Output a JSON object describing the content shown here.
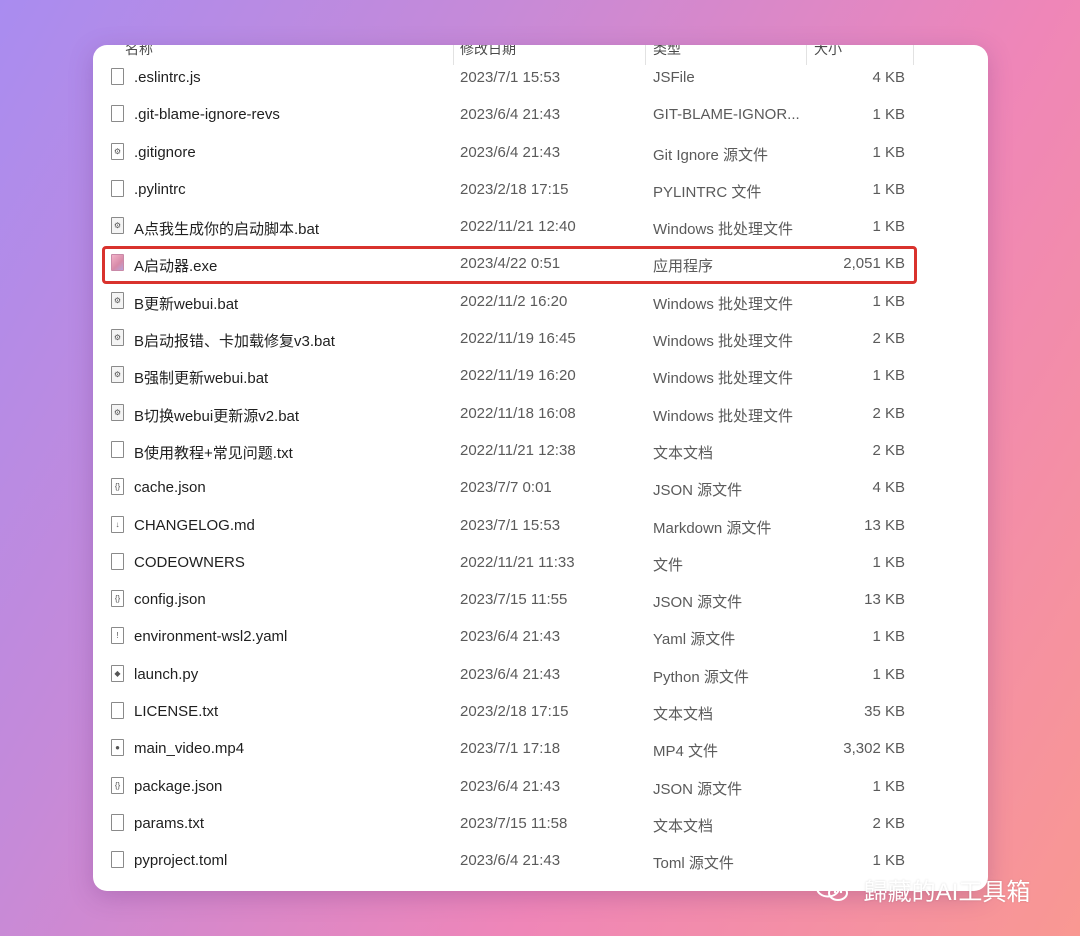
{
  "columns": {
    "name": "名称",
    "date": "修改日期",
    "type": "类型",
    "size": "大小"
  },
  "files": [
    {
      "name": ".eslintrc.js",
      "date": "2023/7/1 15:53",
      "type": "JSFile",
      "size": "4 KB",
      "icon": "text-file-icon"
    },
    {
      "name": ".git-blame-ignore-revs",
      "date": "2023/6/4 21:43",
      "type": "GIT-BLAME-IGNOR...",
      "size": "1 KB",
      "icon": "text-file-icon"
    },
    {
      "name": ".gitignore",
      "date": "2023/6/4 21:43",
      "type": "Git Ignore 源文件",
      "size": "1 KB",
      "icon": "gear-file-icon"
    },
    {
      "name": ".pylintrc",
      "date": "2023/2/18 17:15",
      "type": "PYLINTRC 文件",
      "size": "1 KB",
      "icon": "text-file-icon"
    },
    {
      "name": "A点我生成你的启动脚本.bat",
      "date": "2022/11/21 12:40",
      "type": "Windows 批处理文件",
      "size": "1 KB",
      "icon": "batch-file-icon"
    },
    {
      "name": "A启动器.exe",
      "date": "2023/4/22 0:51",
      "type": "应用程序",
      "size": "2,051 KB",
      "icon": "app-exe-icon"
    },
    {
      "name": "B更新webui.bat",
      "date": "2022/11/2 16:20",
      "type": "Windows 批处理文件",
      "size": "1 KB",
      "icon": "batch-file-icon"
    },
    {
      "name": "B启动报错、卡加载修复v3.bat",
      "date": "2022/11/19 16:45",
      "type": "Windows 批处理文件",
      "size": "2 KB",
      "icon": "batch-file-icon"
    },
    {
      "name": "B强制更新webui.bat",
      "date": "2022/11/19 16:20",
      "type": "Windows 批处理文件",
      "size": "1 KB",
      "icon": "batch-file-icon"
    },
    {
      "name": "B切换webui更新源v2.bat",
      "date": "2022/11/18 16:08",
      "type": "Windows 批处理文件",
      "size": "2 KB",
      "icon": "batch-file-icon"
    },
    {
      "name": "B使用教程+常见问题.txt",
      "date": "2022/11/21 12:38",
      "type": "文本文档",
      "size": "2 KB",
      "icon": "text-file-icon"
    },
    {
      "name": "cache.json",
      "date": "2023/7/7 0:01",
      "type": "JSON 源文件",
      "size": "4 KB",
      "icon": "json-file-icon"
    },
    {
      "name": "CHANGELOG.md",
      "date": "2023/7/1 15:53",
      "type": "Markdown 源文件",
      "size": "13 KB",
      "icon": "markdown-file-icon"
    },
    {
      "name": "CODEOWNERS",
      "date": "2022/11/21 11:33",
      "type": "文件",
      "size": "1 KB",
      "icon": "text-file-icon"
    },
    {
      "name": "config.json",
      "date": "2023/7/15 11:55",
      "type": "JSON 源文件",
      "size": "13 KB",
      "icon": "json-file-icon"
    },
    {
      "name": "environment-wsl2.yaml",
      "date": "2023/6/4 21:43",
      "type": "Yaml 源文件",
      "size": "1 KB",
      "icon": "yaml-file-icon"
    },
    {
      "name": "launch.py",
      "date": "2023/6/4 21:43",
      "type": "Python 源文件",
      "size": "1 KB",
      "icon": "python-file-icon"
    },
    {
      "name": "LICENSE.txt",
      "date": "2023/2/18 17:15",
      "type": "文本文档",
      "size": "35 KB",
      "icon": "text-file-icon"
    },
    {
      "name": "main_video.mp4",
      "date": "2023/7/1 17:18",
      "type": "MP4 文件",
      "size": "3,302 KB",
      "icon": "video-file-icon"
    },
    {
      "name": "package.json",
      "date": "2023/6/4 21:43",
      "type": "JSON 源文件",
      "size": "1 KB",
      "icon": "json-file-icon"
    },
    {
      "name": "params.txt",
      "date": "2023/7/15 11:58",
      "type": "文本文档",
      "size": "2 KB",
      "icon": "text-file-icon"
    },
    {
      "name": "pyproject.toml",
      "date": "2023/6/4 21:43",
      "type": "Toml 源文件",
      "size": "1 KB",
      "icon": "text-file-icon"
    }
  ],
  "highlight_color": "#d9322d",
  "watermark": {
    "text": "歸藏的AI工具箱",
    "icon": "wechat-icon"
  }
}
